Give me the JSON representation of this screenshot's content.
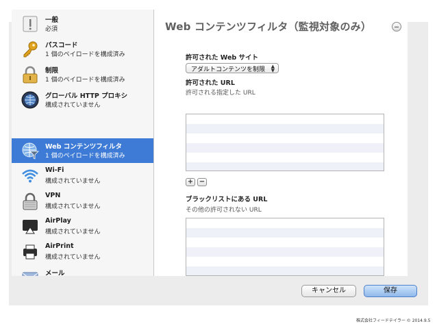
{
  "window": {
    "title": "Web コンテンツフィルタ（監視対象のみ）",
    "sidebar": {
      "items": [
        {
          "name": "一般",
          "sub": "必須",
          "icon": "general-icon"
        },
        {
          "name": "パスコード",
          "sub": "1 個のペイロードを構成済み",
          "icon": "key-icon"
        },
        {
          "name": "制限",
          "sub": "1 個のペイロードを構成済み",
          "icon": "padlock-icon"
        },
        {
          "name": "グローバル HTTP プロキシ",
          "sub": "構成されていません",
          "icon": "globe-proxy-icon"
        },
        {
          "name": "Web コンテンツフィルタ",
          "sub": "1 個のペイロードを構成済み",
          "icon": "web-filter-icon",
          "selected": true
        },
        {
          "name": "Wi-Fi",
          "sub": "構成されていません",
          "icon": "wifi-icon"
        },
        {
          "name": "VPN",
          "sub": "構成されていません",
          "icon": "vpn-lock-icon"
        },
        {
          "name": "AirPlay",
          "sub": "構成されていません",
          "icon": "airplay-icon"
        },
        {
          "name": "AirPrint",
          "sub": "構成されていません",
          "icon": "printer-icon"
        },
        {
          "name": "メール",
          "sub": "",
          "icon": "mail-icon"
        }
      ]
    },
    "main": {
      "allowed_sites_label": "許可された Web サイト",
      "filter_select_value": "アダルトコンテンツを制限",
      "allowed_urls_label": "許可された URL",
      "allowed_urls_desc": "許可される指定した URL",
      "add_label": "+",
      "remove_label": "−",
      "blacklist_label": "ブラックリストにある URL",
      "blacklist_desc": "その他の許可されない URL"
    },
    "buttons": {
      "cancel": "キャンセル",
      "save": "保存"
    }
  },
  "footer": "株式会社フィードテイラー © 2014.9.5",
  "colors": {
    "selected_bg": "#3e7bd6",
    "save_button": "#8fb8ea"
  }
}
